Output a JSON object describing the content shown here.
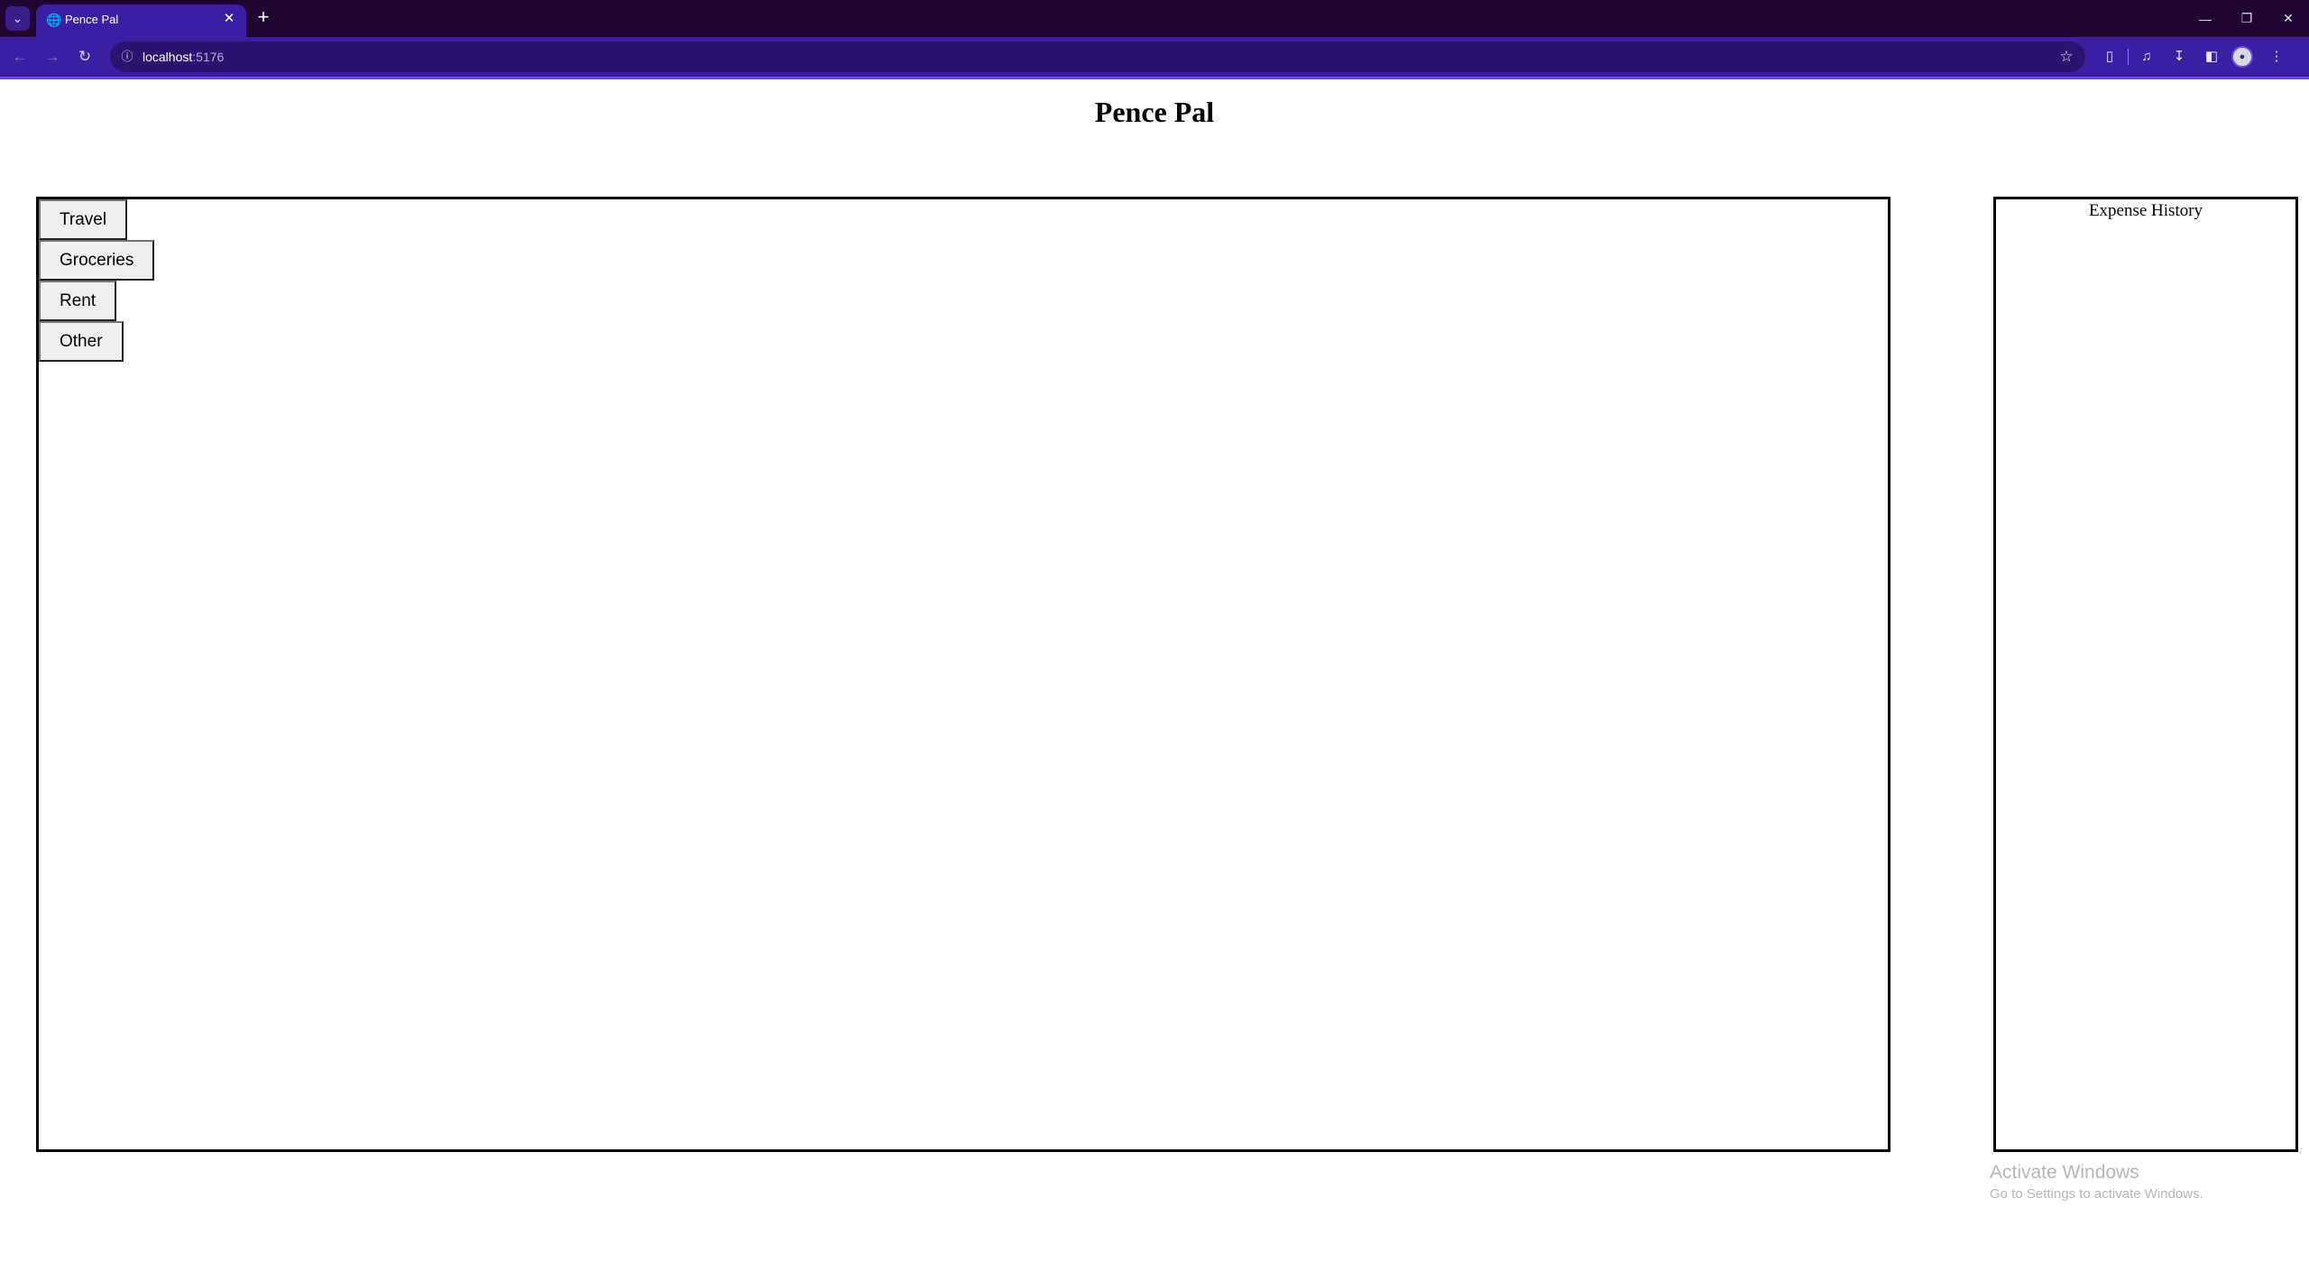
{
  "browser": {
    "tab": {
      "title": "Pence Pal",
      "favicon": "globe-icon",
      "close_icon": "close-icon"
    },
    "new_tab_icon": "plus-icon",
    "window_controls": [
      "minimize-icon",
      "restore-icon",
      "close-icon"
    ],
    "address": {
      "host": "localhost",
      "port": ":5176"
    },
    "toolbar_icons": [
      "extensions-icon",
      "media-controls-icon",
      "download-icon",
      "side-panel-icon",
      "profile-avatar",
      "menu-icon"
    ],
    "colors": {
      "tabstrip": "#1f0630",
      "toolbar": "#3b1fa3",
      "omnibox": "#2a1470"
    }
  },
  "page": {
    "title": "Pence Pal",
    "categories": [
      {
        "label": "Travel"
      },
      {
        "label": "Groceries"
      },
      {
        "label": "Rent"
      },
      {
        "label": "Other"
      }
    ],
    "history": {
      "title": "Expense History"
    }
  },
  "os_watermark": {
    "title": "Activate Windows",
    "subtitle": "Go to Settings to activate Windows."
  }
}
